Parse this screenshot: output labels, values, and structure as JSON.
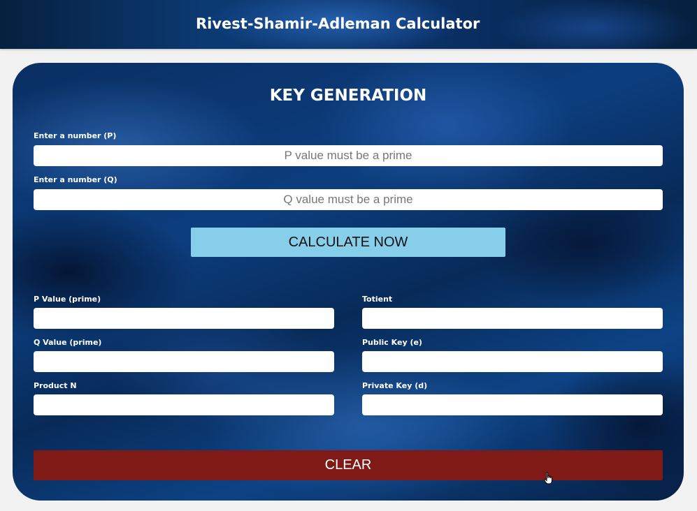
{
  "header": {
    "title": "Rivest-Shamir-Adleman Calculator"
  },
  "key_generation": {
    "title": "KEY GENERATION",
    "p_input": {
      "label": "Enter a number (P)",
      "placeholder": "P value must be a prime",
      "value": ""
    },
    "q_input": {
      "label": "Enter a number (Q)",
      "placeholder": "Q value must be a prime",
      "value": ""
    },
    "calculate_label": "CALCULATE NOW"
  },
  "results": {
    "p_value": {
      "label": "P Value (prime)",
      "value": ""
    },
    "q_value": {
      "label": "Q Value (prime)",
      "value": ""
    },
    "product_n": {
      "label": "Product N",
      "value": ""
    },
    "totient": {
      "label": "Totient",
      "value": ""
    },
    "public_key": {
      "label": "Public Key (e)",
      "value": ""
    },
    "private_key": {
      "label": "Private Key (d)",
      "value": ""
    }
  },
  "clear_label": "CLEAR",
  "colors": {
    "header_bg": "#0b3a73",
    "calculate_button": "#87ceeb",
    "clear_button": "#7f1a17",
    "page_bg": "#f2f2f2"
  },
  "icons": {
    "cursor": "hand-pointer-icon"
  }
}
